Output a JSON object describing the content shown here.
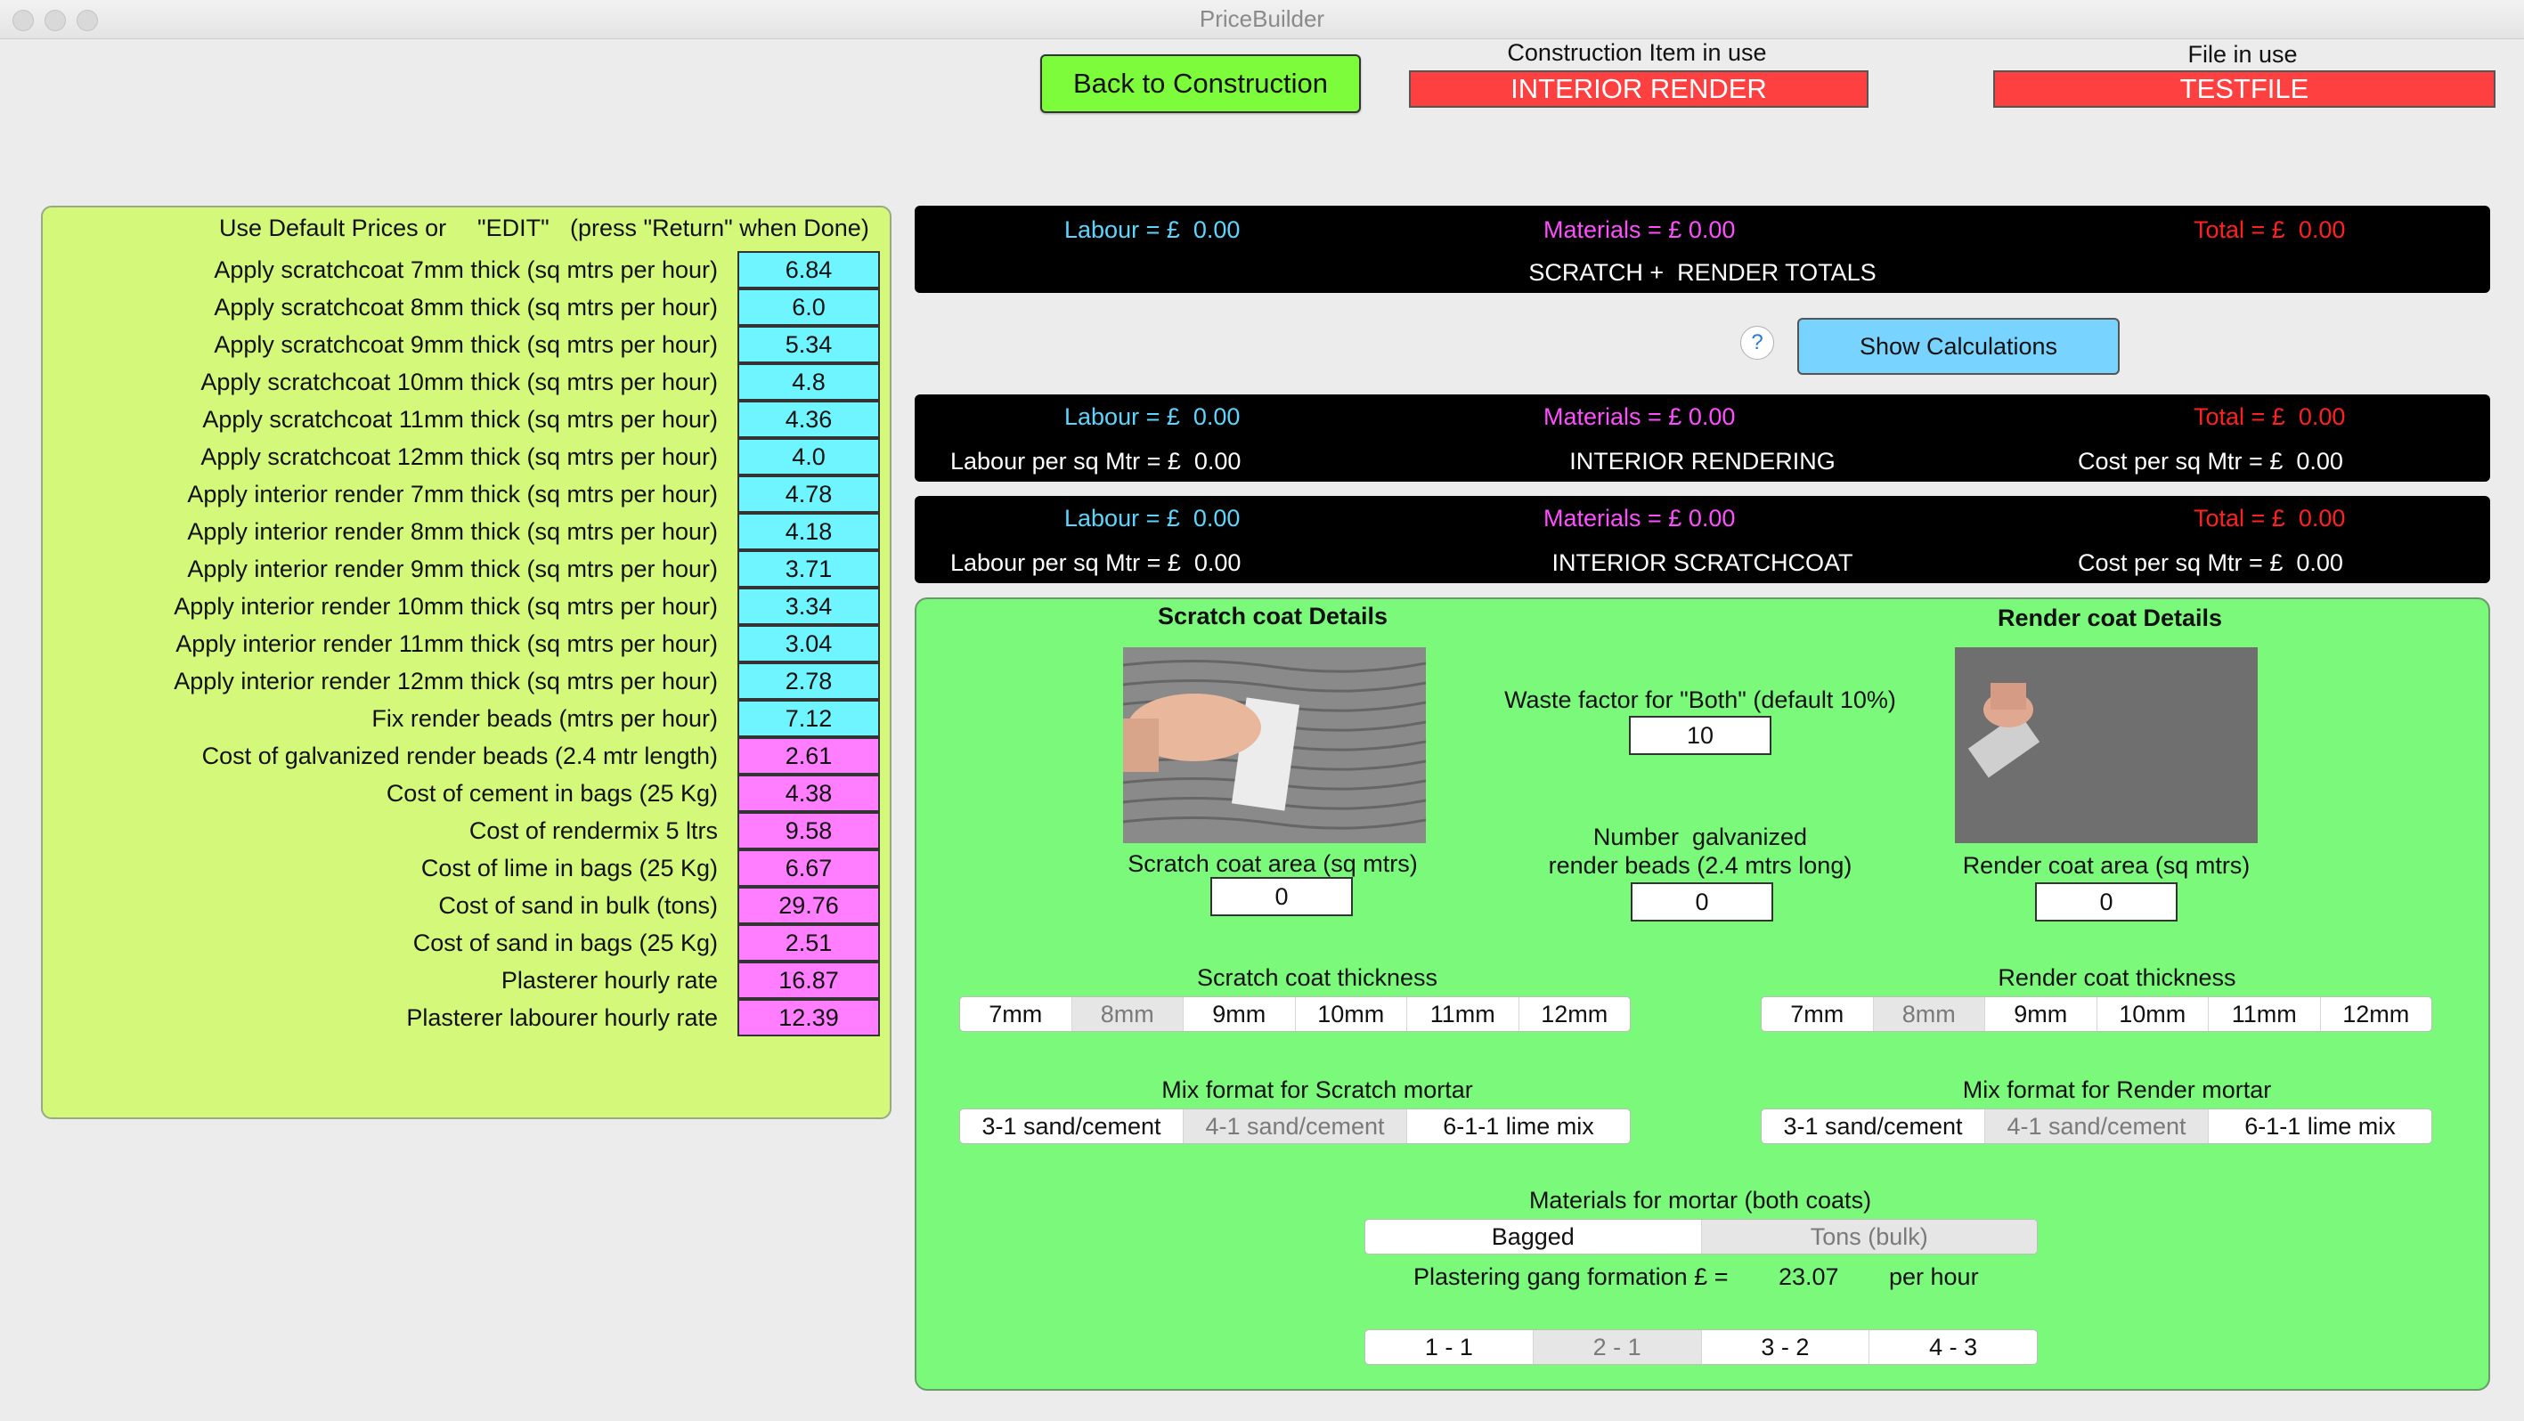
{
  "window": {
    "title": "PriceBuilder"
  },
  "header": {
    "back_button": "Back to Construction",
    "construction_label": "Construction Item in use",
    "construction_value": "INTERIOR RENDER",
    "file_label": "File in use",
    "file_value": "TESTFILE"
  },
  "left_panel": {
    "header_a": "Use Default Prices or",
    "header_b": "\"EDIT\"",
    "header_c": "(press \"Return\" when Done)",
    "rows": [
      {
        "label": "Apply scratchcoat 7mm thick (sq mtrs per hour)",
        "value": "6.84",
        "color": "#6ff5ff"
      },
      {
        "label": "Apply scratchcoat 8mm thick (sq mtrs per hour)",
        "value": "6.0",
        "color": "#6ff5ff"
      },
      {
        "label": "Apply scratchcoat 9mm thick (sq mtrs per hour)",
        "value": "5.34",
        "color": "#6ff5ff"
      },
      {
        "label": "Apply scratchcoat 10mm thick (sq mtrs per hour)",
        "value": "4.8",
        "color": "#6ff5ff"
      },
      {
        "label": "Apply scratchcoat 11mm thick (sq mtrs per hour)",
        "value": "4.36",
        "color": "#6ff5ff"
      },
      {
        "label": "Apply scratchcoat 12mm thick (sq mtrs per hour)",
        "value": "4.0",
        "color": "#6ff5ff"
      },
      {
        "label": "Apply interior render 7mm thick (sq mtrs per hour)",
        "value": "4.78",
        "color": "#6ff5ff"
      },
      {
        "label": "Apply interior render 8mm thick (sq mtrs per hour)",
        "value": "4.18",
        "color": "#6ff5ff"
      },
      {
        "label": "Apply interior render 9mm thick (sq mtrs per hour)",
        "value": "3.71",
        "color": "#6ff5ff"
      },
      {
        "label": "Apply interior render 10mm thick (sq mtrs per hour)",
        "value": "3.34",
        "color": "#6ff5ff"
      },
      {
        "label": "Apply interior render 11mm thick (sq mtrs per hour)",
        "value": "3.04",
        "color": "#6ff5ff"
      },
      {
        "label": "Apply interior render 12mm thick (sq mtrs per hour)",
        "value": "2.78",
        "color": "#6ff5ff"
      },
      {
        "label": "Fix render beads (mtrs per hour)",
        "value": "7.12",
        "color": "#6ff5ff"
      },
      {
        "label": "Cost of galvanized render beads (2.4 mtr length)",
        "value": "2.61",
        "color": "#ff7dff"
      },
      {
        "label": "Cost of cement in bags (25 Kg)",
        "value": "4.38",
        "color": "#ff7dff"
      },
      {
        "label": "Cost of rendermix 5 ltrs",
        "value": "9.58",
        "color": "#ff7dff"
      },
      {
        "label": "Cost of lime in bags (25 Kg)",
        "value": "6.67",
        "color": "#ff7dff"
      },
      {
        "label": "Cost of sand in bulk (tons)",
        "value": "29.76",
        "color": "#ff7dff"
      },
      {
        "label": "Cost of sand in bags (25 Kg)",
        "value": "2.51",
        "color": "#ff7dff"
      },
      {
        "label": "Plasterer hourly rate",
        "value": "16.87",
        "color": "#ff7dff"
      },
      {
        "label": "Plasterer labourer hourly rate",
        "value": "12.39",
        "color": "#ff7dff"
      }
    ]
  },
  "totals_panel": {
    "labour": "Labour = £  0.00",
    "materials": "Materials = £ 0.00",
    "total": "Total = £  0.00",
    "caption": "SCRATCH +  RENDER TOTALS"
  },
  "help_button": "?",
  "show_calculations_button": "Show Calculations",
  "render_panel": {
    "labour": "Labour = £  0.00",
    "materials": "Materials = £ 0.00",
    "total": "Total = £  0.00",
    "labour_per_sq": "Labour per sq Mtr = £  0.00",
    "caption": "INTERIOR RENDERING",
    "cost_per_sq": "Cost per sq Mtr = £  0.00"
  },
  "scratch_panel": {
    "labour": "Labour = £  0.00",
    "materials": "Materials = £ 0.00",
    "total": "Total = £  0.00",
    "labour_per_sq": "Labour per sq Mtr = £  0.00",
    "caption": "INTERIOR SCRATCHCOAT",
    "cost_per_sq": "Cost per sq Mtr = £  0.00"
  },
  "details": {
    "scratch_title": "Scratch coat Details",
    "render_title": "Render coat Details",
    "waste_label": "Waste factor for \"Both\" (default 10%)",
    "waste_value": "10",
    "beads_label_1": "Number  galvanized",
    "beads_label_2": "render beads (2.4 mtrs long)",
    "beads_value": "0",
    "scratch_area_label": "Scratch coat area (sq mtrs)",
    "scratch_area_value": "0",
    "render_area_label": "Render coat area (sq mtrs)",
    "render_area_value": "0",
    "scratch_thickness_label": "Scratch coat thickness",
    "render_thickness_label": "Render coat thickness",
    "thickness_options": [
      "7mm",
      "8mm",
      "9mm",
      "10mm",
      "11mm",
      "12mm"
    ],
    "scratch_thickness_selected": "8mm",
    "render_thickness_selected": "8mm",
    "scratch_mix_label": "Mix format for Scratch mortar",
    "render_mix_label": "Mix format for Render mortar",
    "mix_options": [
      "3-1 sand/cement",
      "4-1 sand/cement",
      "6-1-1 lime mix"
    ],
    "scratch_mix_selected": "4-1 sand/cement",
    "render_mix_selected": "4-1 sand/cement",
    "materials_label": "Materials for mortar (both coats)",
    "materials_options": [
      "Bagged",
      "Tons (bulk)"
    ],
    "materials_selected": "Tons (bulk)",
    "gang_label": "Plastering gang formation £ =",
    "gang_value": "23.07",
    "gang_unit": "per hour",
    "gang_options": [
      "1 - 1",
      "2 - 1",
      "3 - 2",
      "4 - 3"
    ],
    "gang_selected": "2 - 1"
  }
}
